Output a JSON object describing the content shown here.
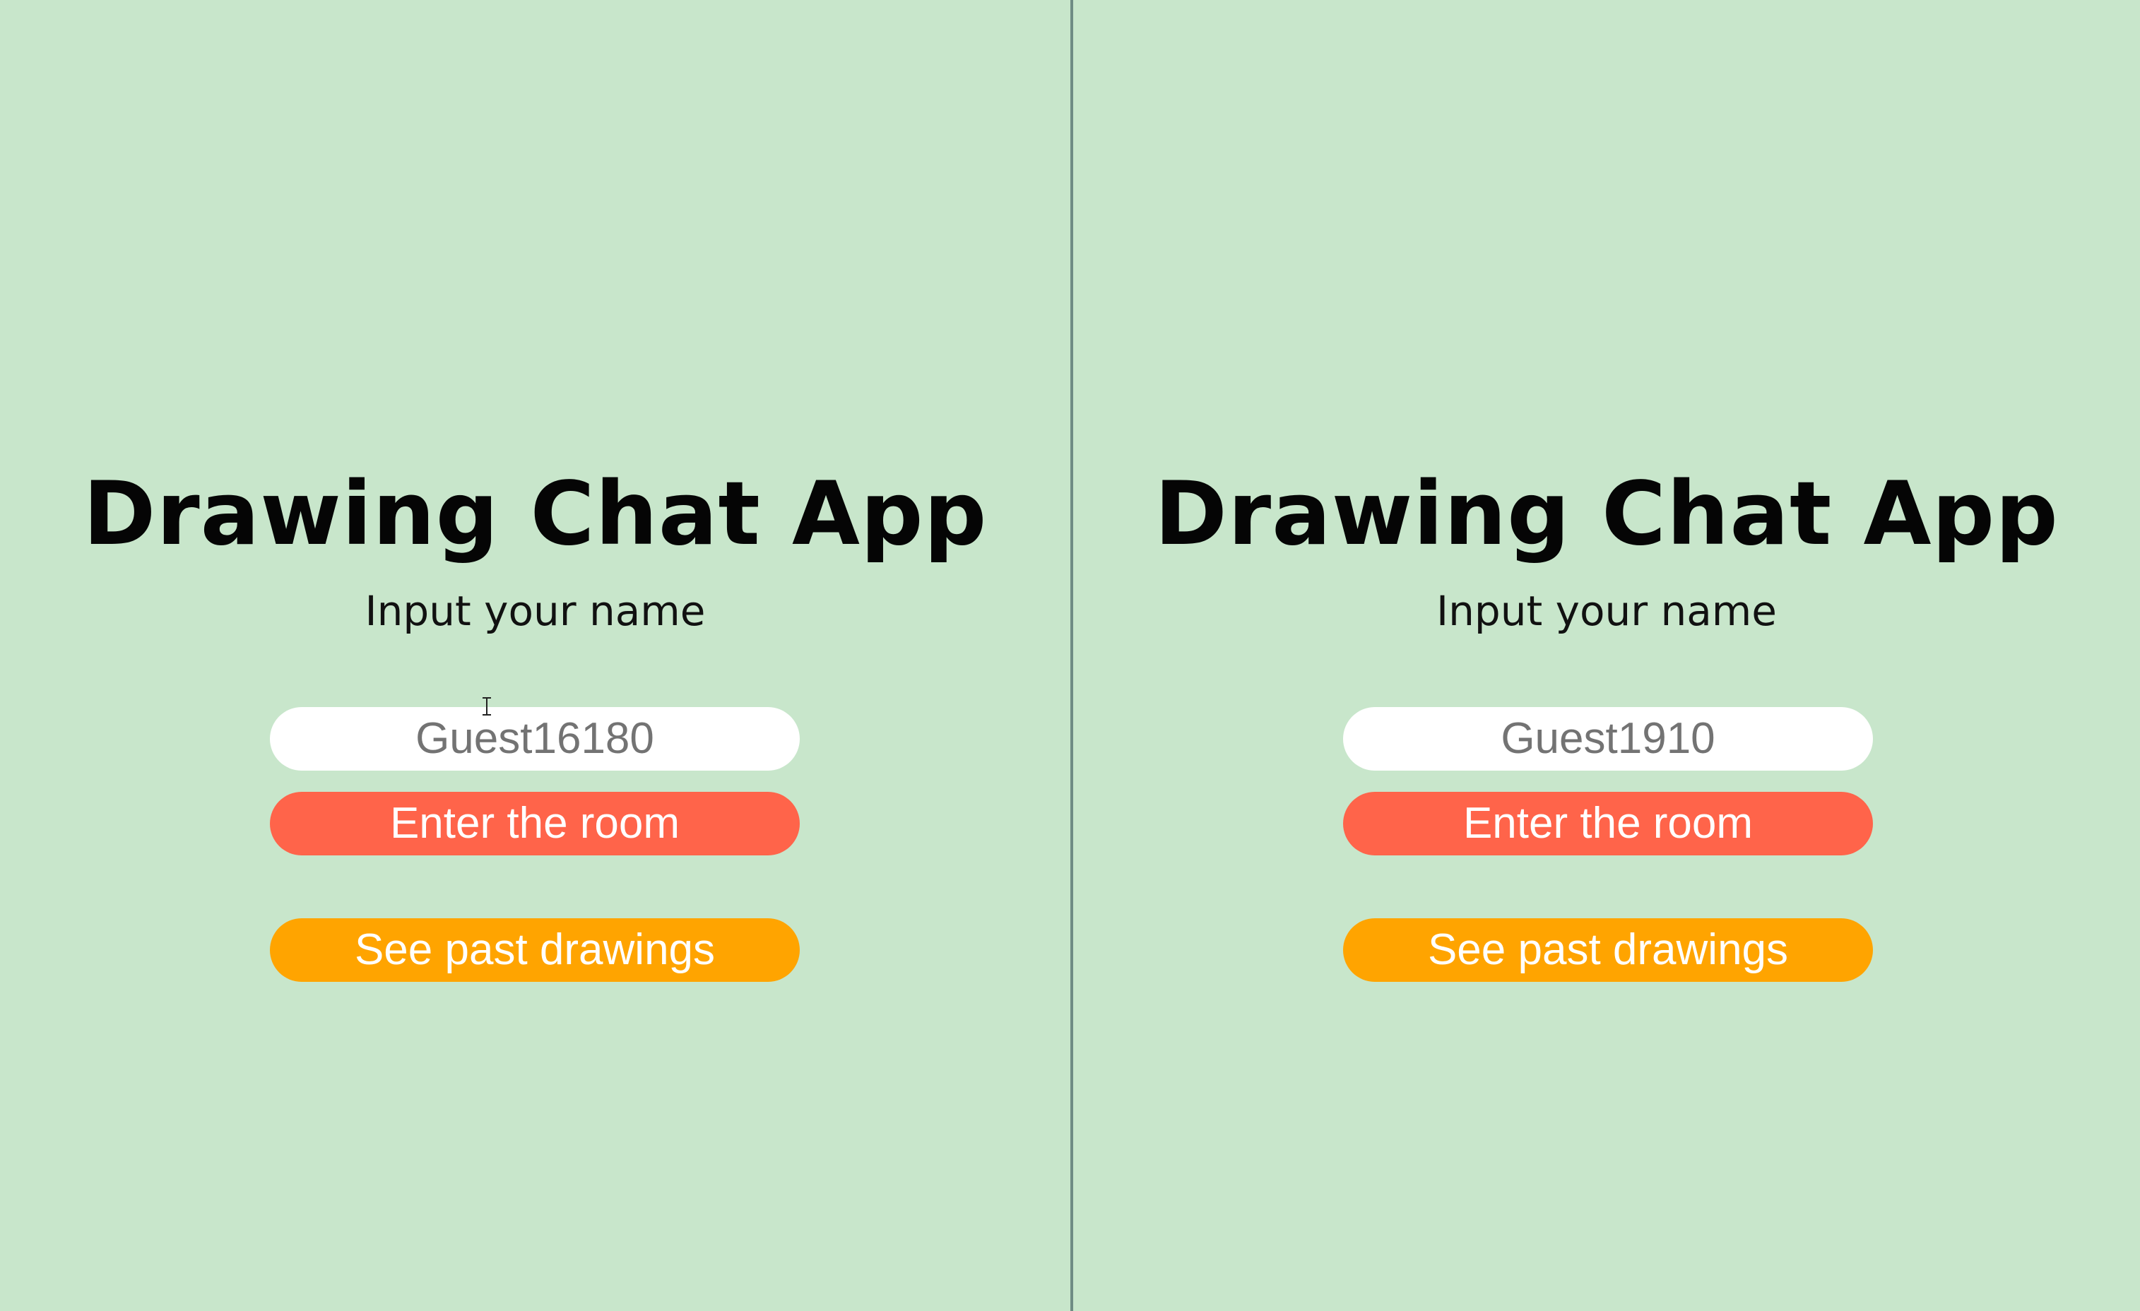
{
  "colors": {
    "background": "#c8e6cb",
    "divider": "#6f8c84",
    "title": "#050505",
    "input_background": "#ffffff",
    "input_text": "#737373",
    "enter_button": "#ff644a",
    "past_button": "#ffa400",
    "button_text": "#ffffff"
  },
  "panes": [
    {
      "title": "Drawing Chat App",
      "prompt": "Input your name",
      "name_input_value": "Guest16180",
      "enter_button_label": "Enter the room",
      "past_button_label": "See past drawings",
      "cursor_icon": "text-cursor-icon"
    },
    {
      "title": "Drawing Chat App",
      "prompt": "Input your name",
      "name_input_value": "Guest1910",
      "enter_button_label": "Enter the room",
      "past_button_label": "See past drawings"
    }
  ]
}
